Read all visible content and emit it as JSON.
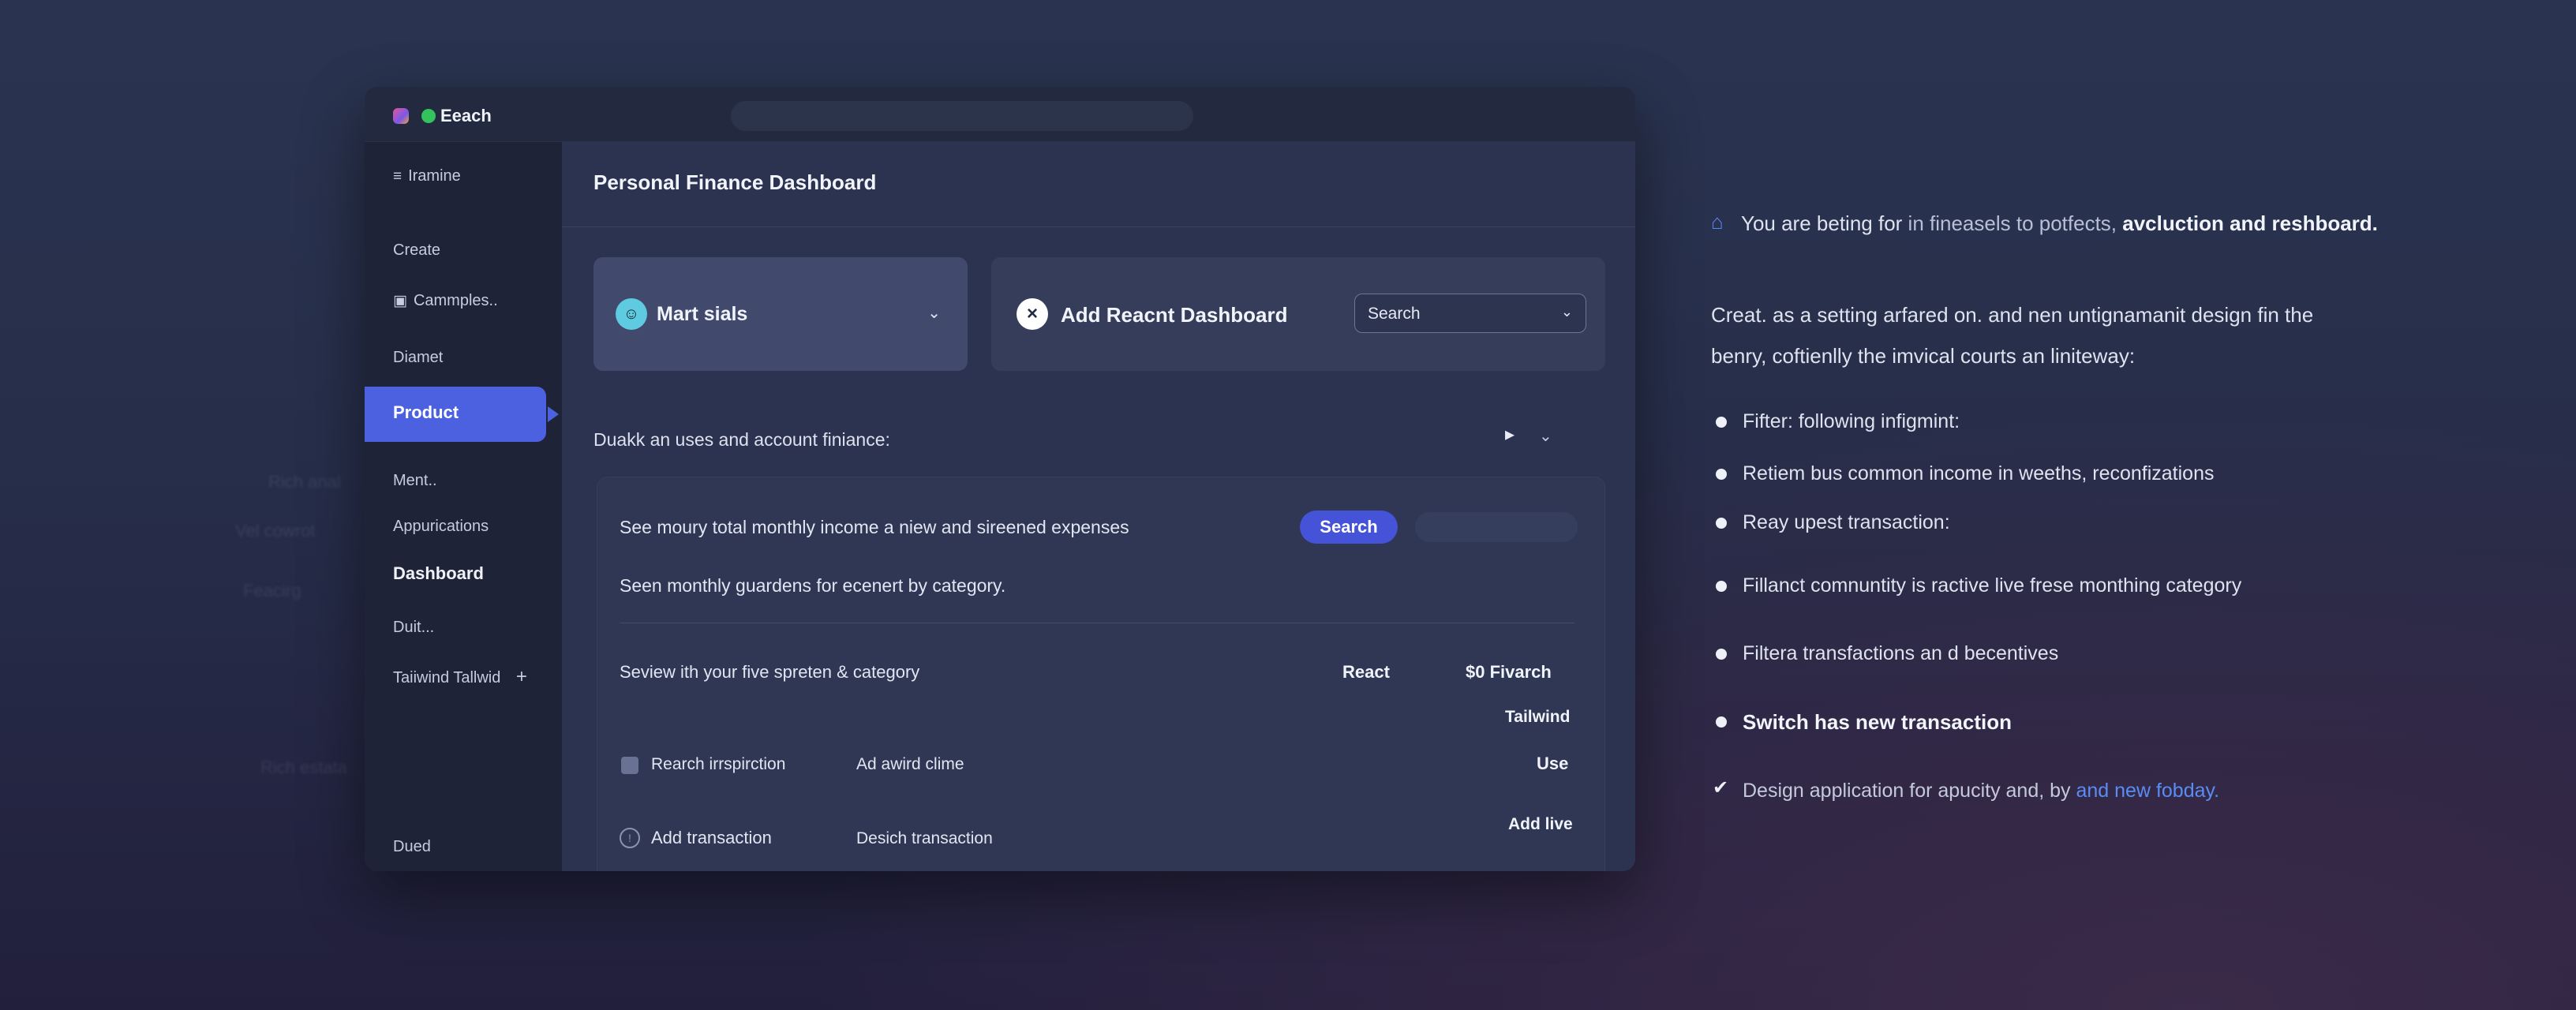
{
  "window": {
    "app_name": "Eeach"
  },
  "sidebar": {
    "items": [
      {
        "label": "Iramine",
        "icon": "menu-icon"
      },
      {
        "label": "Create"
      },
      {
        "label": "Cammples..",
        "icon": "lock-icon"
      },
      {
        "label": "Diamet"
      },
      {
        "label": "Product",
        "active": true
      },
      {
        "label": "Ment.."
      },
      {
        "label": "Appurications"
      },
      {
        "label": "Dashboard",
        "bold": true
      },
      {
        "label": "Duit..."
      },
      {
        "label": "Taiiwind Tallwid",
        "icon": "plus-icon"
      },
      {
        "label": "Dued"
      }
    ]
  },
  "main": {
    "title": "Personal Finance Dashboard",
    "card1": {
      "label": "Mart sials",
      "icon": "user-icon"
    },
    "card2": {
      "label": "Add Reacnt Dashboard",
      "icon": "close-icon",
      "select_value": "Search"
    },
    "section_label": "Duakk an uses and account finiance:",
    "panel": {
      "row1_text": "See moury total monthly income a niew and sireened expenses",
      "search_button": "Search",
      "row2_text": "Seen monthly guardens for ecenert by category.",
      "row3_text": "Seview ith your five spreten & category",
      "row3_col1": "React",
      "row3_col2": "$0 Fivarch",
      "row3b_col2": "Tailwind",
      "row4_label": "Rearch irrspirction",
      "row4_mid": "Ad awird clime",
      "row4_right": "Use",
      "row5_right_top": "Add live",
      "row5_label": "Add transaction",
      "row5_mid": "Desich transaction"
    }
  },
  "info": {
    "intro_a": "You are beting for",
    "intro_b": "in fineasels to potfects,",
    "intro_c": "avcluction and reshboard.",
    "para_line1": "Creat. as a setting arfared on. and nen untignamanit design fin the",
    "para_line2": "benry, coftienlly the imvical courts an liniteway:",
    "bullets": [
      "Fifter: following infigmint:",
      "Retiem bus common income in weeths, reconfizations",
      "Reay upest transaction:",
      "Fillanct comnuntity is ractive live frese monthing category",
      "Filtera transfactions an d becentives",
      "Switch has new transaction"
    ],
    "final_prefix": "Design application for apucity and, by",
    "final_link": "and new fobday.",
    "accent_color": "#5a8cf4"
  },
  "ghost_labels": [
    "Rich anal",
    "Vel cowrot",
    "Feacirg",
    "Rich estata"
  ]
}
